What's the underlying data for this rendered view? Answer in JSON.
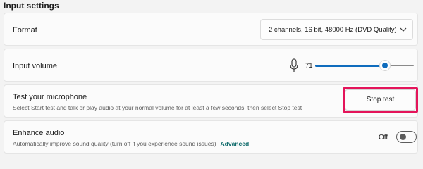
{
  "header": {
    "title": "Input settings"
  },
  "format": {
    "label": "Format",
    "selected": "2 channels, 16 bit, 48000 Hz (DVD Quality)",
    "icon": "chevron-down-icon"
  },
  "volume": {
    "label": "Input volume",
    "value": "71",
    "level": 0.71,
    "icon": "microphone-icon",
    "accent": "#0f6cbd"
  },
  "test": {
    "title": "Test your microphone",
    "description": "Select Start test and talk or play audio at your normal volume for at least a few seconds, then select Stop test",
    "button_label": "Stop test",
    "highlight_color": "#e4145a"
  },
  "enhance": {
    "title": "Enhance audio",
    "description": "Automatically improve sound quality (turn off if you experience sound issues)",
    "link_label": "Advanced",
    "toggle_state": "Off"
  }
}
